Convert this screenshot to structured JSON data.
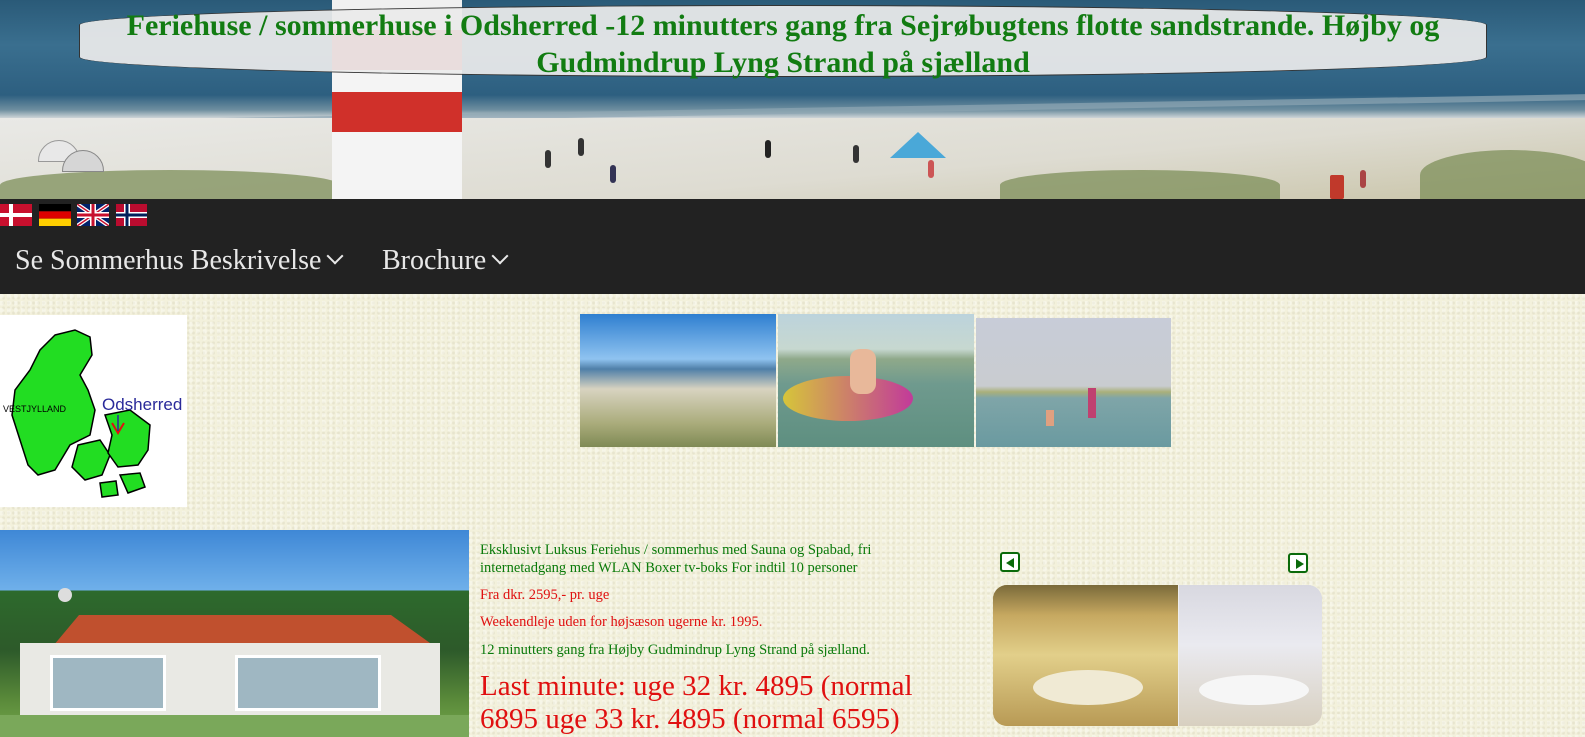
{
  "header": {
    "title": "Feriehuse / sommerhuse i Odsherred -12 minutters gang fra Sejrøbugtens flotte sandstrande. Højby og Gudmindrup Lyng Strand på sjælland"
  },
  "languages": [
    {
      "name": "danish-flag-icon"
    },
    {
      "name": "german-flag-icon"
    },
    {
      "name": "uk-flag-icon"
    },
    {
      "name": "norwegian-flag-icon"
    }
  ],
  "nav": {
    "items": [
      {
        "label": "Se Sommerhus Beskrivelse"
      },
      {
        "label": "Brochure"
      }
    ]
  },
  "map": {
    "label_region": "VESTJYLLAND",
    "label_place": "Odsherred"
  },
  "content": {
    "line1": "Eksklusivt Luksus Feriehus / sommerhus med Sauna og Spabad, fri internetadgang med WLAN Boxer tv-boks For indtil 10 personer",
    "line2": "Fra dkr. 2595,- pr. uge",
    "line3": "Weekendleje uden for højsæson ugerne kr. 1995.",
    "line4": "12 minutters gang fra Højby Gudmindrup Lyng Strand på sjælland.",
    "last_minute": "Last minute: uge 32 kr. 4895 (normal 6895 uge 33 kr. 4895 (normal 6595)"
  },
  "colors": {
    "title_green": "#127c12",
    "text_green": "#0a7a0a",
    "text_red": "#e01010",
    "nav_bg": "#222222",
    "page_bg": "#f3f1dc"
  }
}
